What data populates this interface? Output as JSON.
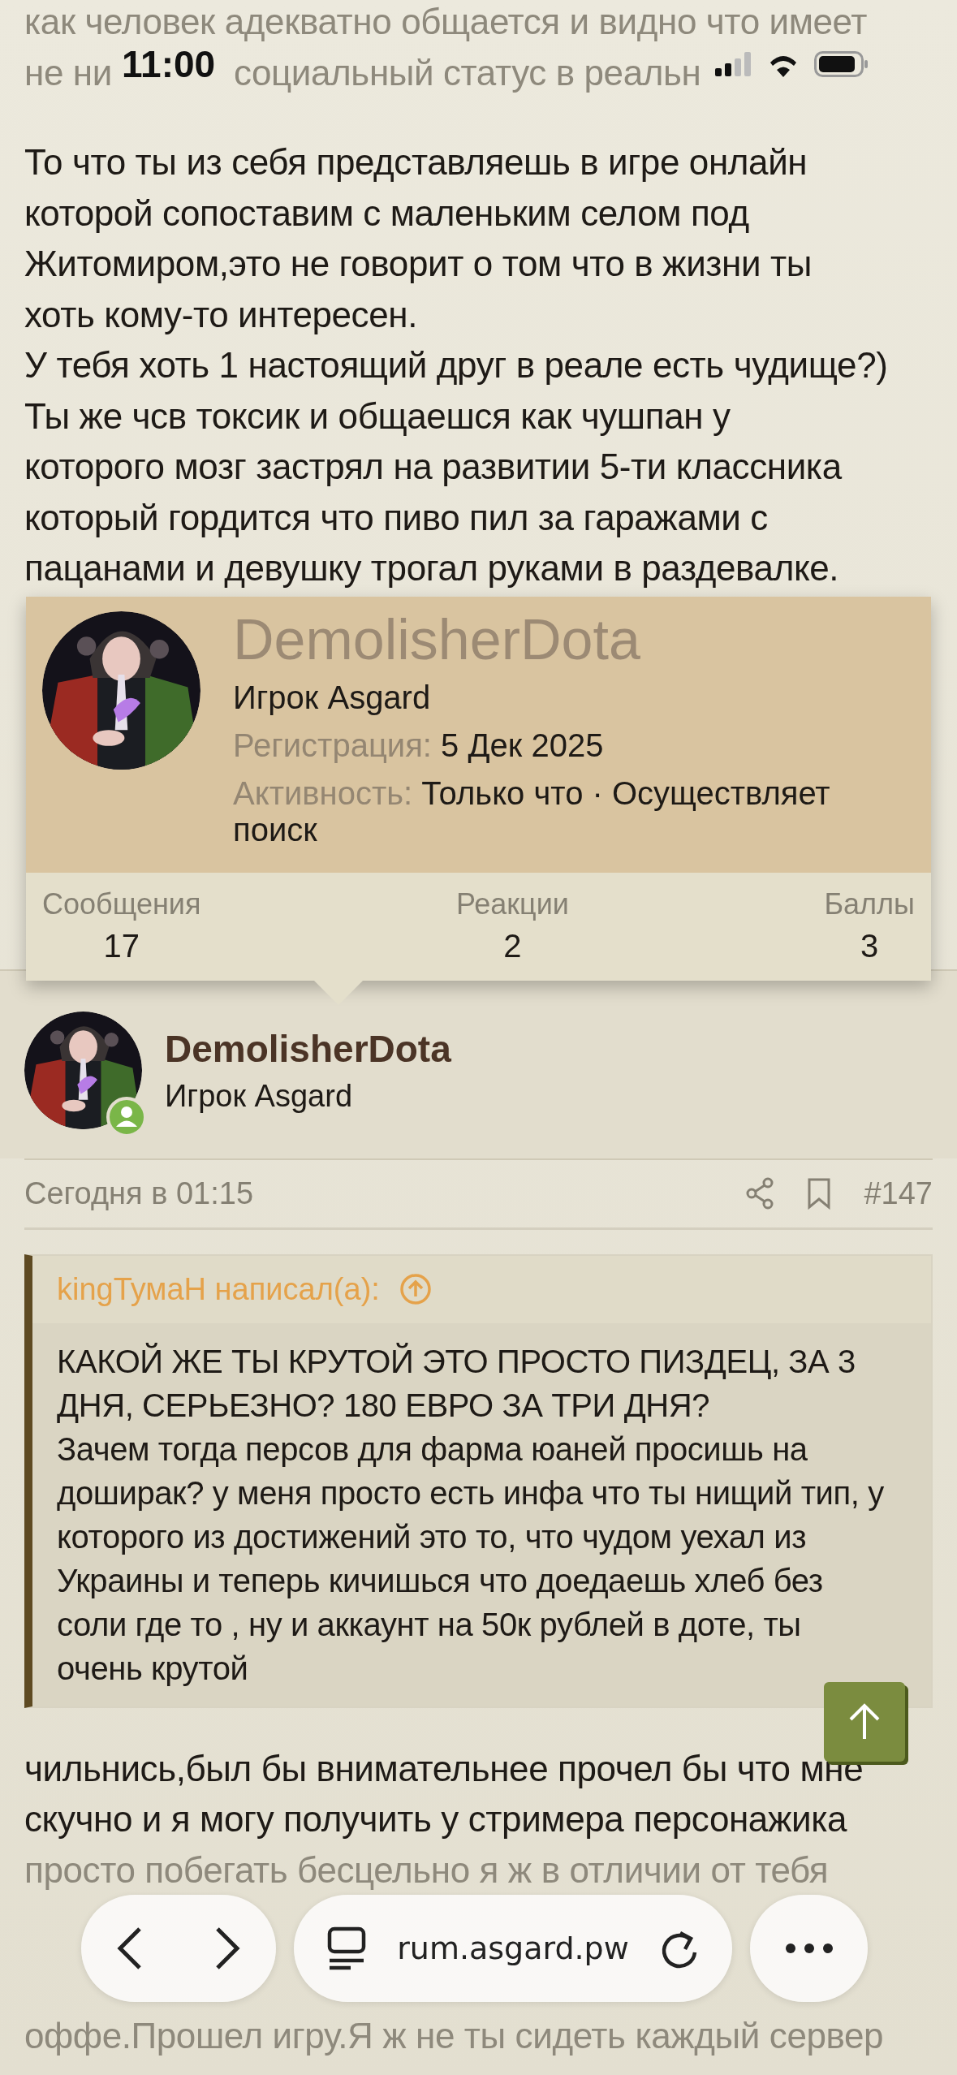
{
  "status_bar": {
    "time": "11:00"
  },
  "previous_text": {
    "line": "как человек адекватно общается и видно что имеет",
    "partial_line": [
      "не ни",
      "социальный статус в реальн"
    ]
  },
  "message_text": "То что ты из себя представляешь в игре онлайн\nкоторой сопоставим с маленьким селом под\nЖитомиром,это не говорит о том что в жизни ты\nхоть кому-то интересен.\nУ тебя хоть 1 настоящий друг в реале есть чудище?)\nТы же чсв токсик и общаешся как чушпан у\nкоторого мозг застрял на развитии 5-ти классника\nкоторый гордится что пиво пил за гаражами с\nпацанами и девушку трогал руками в раздевалке.",
  "member_card": {
    "username": "DemolisherDota",
    "title": "Игрок Asgard",
    "registered_label": "Регистрация:",
    "registered_value": "5 Дек 2025",
    "activity_label": "Активность:",
    "activity_value": "Только что · Осуществляет поиск",
    "stats": [
      {
        "label": "Сообщения",
        "value": "17"
      },
      {
        "label": "Реакции",
        "value": "2"
      },
      {
        "label": "Баллы",
        "value": "3"
      }
    ]
  },
  "post": {
    "author": "DemolisherDota",
    "title": "Игрок Asgard",
    "online": true,
    "date": "Сегодня в 01:15",
    "number": "#147",
    "quote": {
      "author": "kingТумаН написал(а):",
      "paragraphs": [
        "КАКОЙ ЖЕ ТЫ КРУТОЙ ЭТО ПРОСТО ПИЗДЕЦ, ЗА 3\nДНЯ, СЕРЬЕЗНО? 180 ЕВРО ЗА ТРИ ДНЯ?",
        "Зачем тогда персов для фарма юаней просишь на\nдоширак? у меня просто есть инфа что ты нищий тип, у\nкоторого из достижений это то, что чудом уехал из\nУкраины и теперь кичишься что доедаешь хлеб без\nсоли где то , ну и аккаунт на 50к рублей в доте, ты\nочень крутой"
      ]
    },
    "body_lines": [
      "чильнись,был бы внимательнее прочел бы что мне",
      "скучно и я могу получить у стримера персонажика",
      "просто побегать бесцельно я ж в отличии от тебя"
    ],
    "body_tail_line": "оффе.Прошел игру.Я ж не ты сидеть каждый сервер"
  },
  "browser_bar": {
    "url": "rum.asgard.pw"
  }
}
